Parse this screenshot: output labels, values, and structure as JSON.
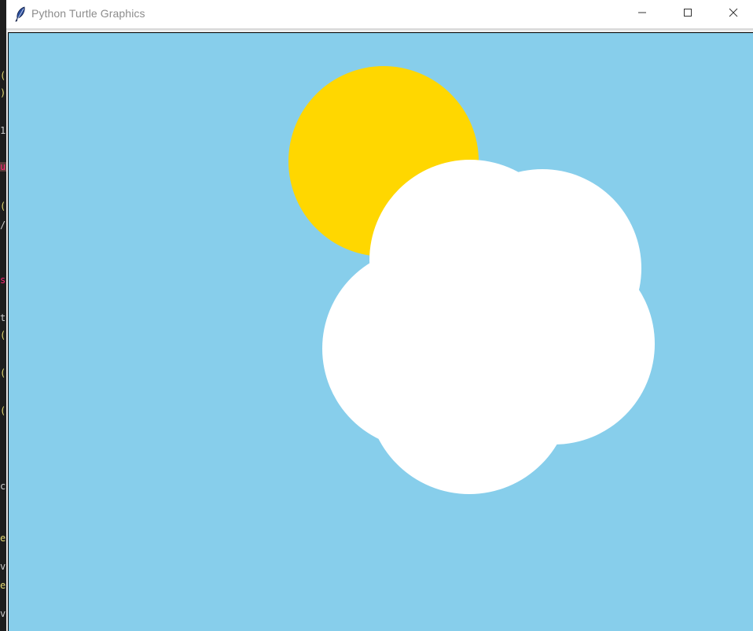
{
  "window": {
    "title": "Python Turtle Graphics",
    "icon": "feather-icon",
    "controls": [
      "minimize-icon",
      "maximize-icon",
      "close-icon"
    ]
  },
  "canvas": {
    "background_color": "#87ceeb",
    "shapes": [
      {
        "name": "sun",
        "color": "#ffd700"
      },
      {
        "name": "cloud",
        "color": "#ffffff"
      }
    ]
  }
}
